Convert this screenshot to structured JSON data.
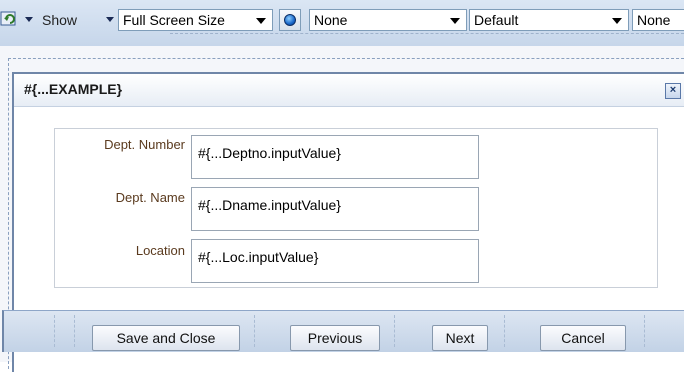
{
  "toolbar": {
    "show_label": "Show",
    "size_combo": "Full Screen Size",
    "combo_none": "None",
    "combo_default": "Default",
    "combo_none_2": "None"
  },
  "dialog": {
    "title": "#{...EXAMPLE}",
    "close_glyph": "×",
    "fields": [
      {
        "label": "Dept. Number",
        "value": "#{...Deptno.inputValue}"
      },
      {
        "label": "Dept. Name",
        "value": "#{...Dname.inputValue}"
      },
      {
        "label": "Location",
        "value": "#{...Loc.inputValue}"
      }
    ],
    "buttons": {
      "save_close": "Save and Close",
      "previous": "Previous",
      "next": "Next",
      "cancel": "Cancel"
    }
  },
  "colors": {
    "toolbar_bg": "#cbd9ea",
    "dialog_border": "#6f86a8",
    "label_text": "#5a3a1e"
  }
}
